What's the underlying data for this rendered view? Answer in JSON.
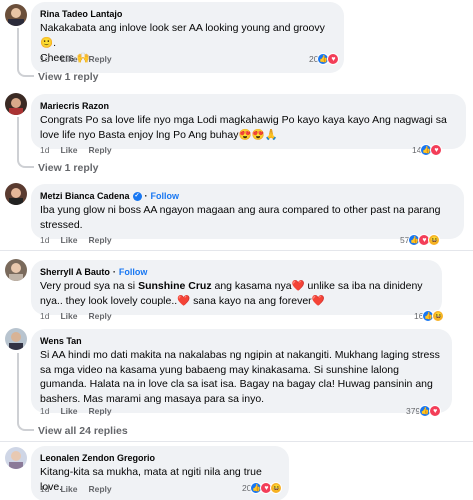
{
  "comments": [
    {
      "author": "Rina Tadeo Lantajo",
      "text": "Nakakabata ang inlove look ser AA looking young and groovy 🙂.",
      "text2": "Cheers 🙌",
      "time": "1d",
      "like": "Like",
      "reply": "Reply",
      "reaction_count": "20",
      "replies": "View 1 reply"
    },
    {
      "author": "Mariecris Razon",
      "text": "Congrats Po sa love life nyo mga Lodi magkahawig Po kayo kaya kayo Ang nagwagi sa love life nyo Basta enjoy lng Po Ang buhay😍😍🙏",
      "time": "1d",
      "like": "Like",
      "reply": "Reply",
      "reaction_count": "14",
      "replies": "View 1 reply"
    },
    {
      "author": "Metzi Bianca Cadena",
      "follow": "Follow",
      "separator": "·",
      "text": "Iba yung glow ni boss AA ngayon magaan ang aura compared to other past na parang stressed.",
      "time": "1d",
      "like": "Like",
      "reply": "Reply",
      "reaction_count": "57"
    },
    {
      "author": "Sherryll A Bauto",
      "follow": "Follow",
      "separator": "·",
      "text_a": "Very proud sya na si ",
      "text_b": "Sunshine Cruz",
      "text_c": " ang kasama nya",
      "text_d": " unlike sa iba na dinideny nya.. they look lovely couple..",
      "text_e": " sana kayo na ang forever",
      "heart": "❤️",
      "time": "1d",
      "like": "Like",
      "reply": "Reply",
      "reaction_count": "16"
    },
    {
      "author": "Wens Tan",
      "text": "Si AA hindi mo dati makita na nakalabas ng ngipin at nakangiti. Mukhang laging stress sa mga video na kasama yung babaeng may kinakasama. Si sunshine lalong gumanda. Halata na in love cla sa isat isa. Bagay na bagay cla! Huwag pansinin ang bashers. Mas marami ang masaya para sa inyo.",
      "time": "1d",
      "like": "Like",
      "reply": "Reply",
      "reaction_count": "379",
      "replies": "View all 24 replies"
    },
    {
      "author": "Leonalen Zendon Gregorio",
      "text": "Kitang-kita sa mukha, mata at ngiti nila ang true love.",
      "time": "1d",
      "like": "Like",
      "reply": "Reply",
      "reaction_count": "20"
    }
  ],
  "colors": {
    "bubble": "#f0f2f5",
    "meta": "#65676b",
    "link": "#1877f2",
    "heart": "#e41e3f"
  }
}
